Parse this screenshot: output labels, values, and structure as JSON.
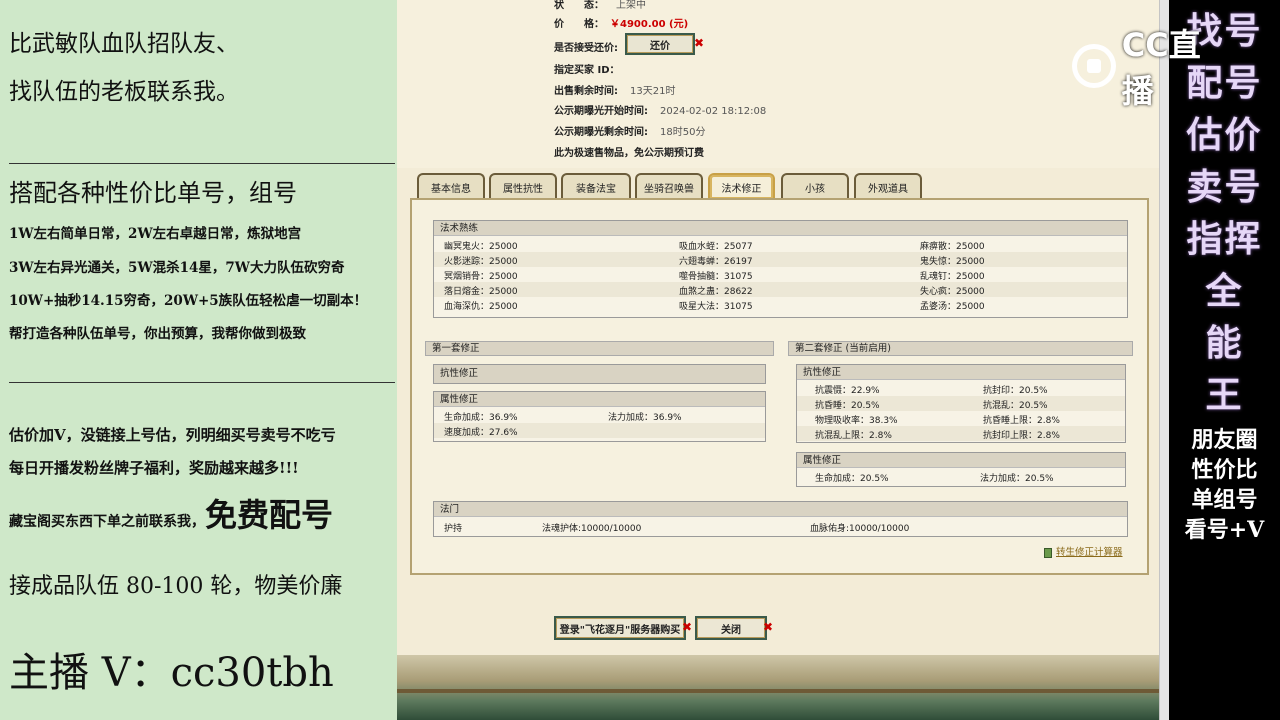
{
  "left": {
    "recruit_line1": "比武敏队血队招队友、",
    "recruit_line2": "找队伍的老板联系我。",
    "combo_title": "搭配各种性价比单号，组号",
    "combo_items": [
      "1W左右简单日常，2W左右卓越日常，炼狱地宫",
      "3W左右异光通关，5W混杀14星，7W大力队伍砍穷奇",
      "10W+抽秒14.15穷奇，20W+5族队伍轻松虐一切副本！",
      "帮打造各种队伍单号，你出预算，我帮你做到极致"
    ],
    "estimate_line": "估价加V，没链接上号估，列明细买号卖号不吃亏",
    "fan_line": "每日开播发粉丝牌子福利，奖励越来越多!!!",
    "treasure_prefix": "藏宝阁买东西下单之前联系我，",
    "treasure_highlight": "免费配号",
    "team_line": "接成品队伍 80-100 轮，物美价廉",
    "host_line": "主播 V：cc30tbh"
  },
  "info": {
    "status_label": "状　　态：",
    "status_value": "上架中",
    "price_label": "价　　格：",
    "price_value": "￥4900.00 (元)",
    "bargain_label": "是否接受还价:",
    "bargain_button": "还价",
    "buyer_label": "指定买家 ID：",
    "remain_label": "出售剩余时间:",
    "remain_value": "13天21时",
    "public_start_label": "公示期曝光开始时间:",
    "public_start_value": "2024-02-02 18:12:08",
    "public_remain_label": "公示期曝光剩余时间:",
    "public_remain_value": "18时50分",
    "fast_note": "此为极速售物品，免公示期预订费"
  },
  "tabs": [
    "基本信息",
    "属性抗性",
    "装备法宝",
    "坐骑召唤兽",
    "法术修正",
    "小孩",
    "外观道具"
  ],
  "magic": {
    "title": "法术熟练",
    "rows": [
      [
        "幽冥鬼火：25000",
        "吸血水蛭：25077",
        "麻痹散：25000"
      ],
      [
        "火影迷踪：25000",
        "六翅毒蝉：26197",
        "鬼失惊：25000"
      ],
      [
        "冥烟销骨：25000",
        "噬骨抽髓：31075",
        "乱魂钉：25000"
      ],
      [
        "落日熔金：25000",
        "血煞之蛊：28622",
        "失心疯：25000"
      ],
      [
        "血海深仇：25000",
        "吸星大法：31075",
        "孟婆汤：25000"
      ]
    ]
  },
  "set1": {
    "title": "第一套修正",
    "resist_title": "抗性修正",
    "attr_title": "属性修正",
    "attr_rows": [
      [
        "生命加成：36.9%",
        "法力加成：36.9%"
      ],
      [
        "速度加成：27.6%",
        ""
      ]
    ]
  },
  "set2": {
    "title": "第二套修正 (当前启用)",
    "resist_title": "抗性修正",
    "resist_rows": [
      [
        "抗震慑：22.9%",
        "抗封印：20.5%"
      ],
      [
        "抗昏睡：20.5%",
        "抗混乱：20.5%"
      ],
      [
        "物理吸收率：38.3%",
        "抗昏睡上限：2.8%"
      ],
      [
        "抗混乱上限：2.8%",
        "抗封印上限：2.8%"
      ]
    ],
    "attr_title": "属性修正",
    "attr_rows": [
      [
        "生命加成：20.5%",
        "法力加成：20.5%"
      ]
    ]
  },
  "faman": {
    "title": "法门",
    "cells": [
      "护持",
      "法魂护体:10000/10000",
      "血脉佑身:10000/10000"
    ]
  },
  "calc_link": "转生修正计算器",
  "bottom": {
    "login_button": "登录\"飞花逐月\"服务器购买",
    "close_button": "关闭"
  },
  "right": {
    "big_lines": [
      "找号",
      "配号",
      "估价",
      "卖号",
      "指挥",
      "全",
      "能",
      "王"
    ],
    "small_lines": [
      "朋友圈",
      "性价比",
      "单组号",
      "看号+V"
    ]
  },
  "logo_text": "CC直播"
}
